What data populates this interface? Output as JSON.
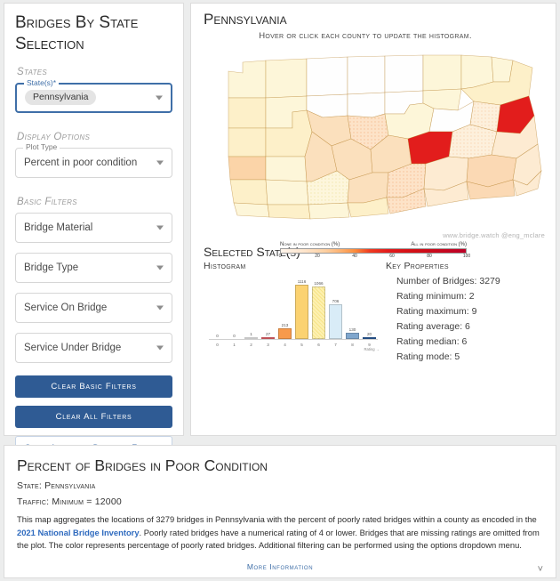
{
  "sidebar": {
    "title": "Bridges By State Selection",
    "groups": [
      {
        "label": "States",
        "fields": [
          {
            "legend": "State(s)*",
            "value": "Pennsylvania",
            "type": "chip",
            "icon": "chevron-down-icon"
          }
        ]
      },
      {
        "label": "Display Options",
        "fields": [
          {
            "legend": "Plot Type",
            "value": "Percent in poor condition",
            "type": "text",
            "icon": "chevron-down-icon"
          }
        ]
      },
      {
        "label": "Basic Filters",
        "fields": [
          {
            "legend": "",
            "value": "Bridge Material",
            "type": "text",
            "icon": "chevron-down-icon"
          },
          {
            "legend": "",
            "value": "Bridge Type",
            "type": "text",
            "icon": "chevron-down-icon"
          },
          {
            "legend": "",
            "value": "Service On Bridge",
            "type": "text",
            "icon": "chevron-down-icon"
          },
          {
            "legend": "",
            "value": "Service Under Bridge",
            "type": "text",
            "icon": "chevron-down-icon"
          }
        ]
      }
    ],
    "buttons": {
      "clear_basic": "Clear Basic Filters",
      "clear_all": "Clear All Filters",
      "advanced": "Show Advanced Detailed Filters",
      "advanced_icon": "chevron-down-icon"
    }
  },
  "map": {
    "title": "Pennsylvania",
    "subtitle": "Hover or click each county to update the histogram.",
    "watermark": "www.bridge.watch @eng_mclare",
    "colorbar": {
      "left_label": "None in poor condition (%)",
      "right_label": "All in poor condition (%)",
      "ticks": [
        "0",
        "20",
        "40",
        "60",
        "80",
        "100"
      ],
      "tick_values": [
        0,
        20,
        40,
        60,
        80,
        100
      ],
      "low_color": "#fff5eb",
      "high_color": "#bd0026"
    }
  },
  "selected_state": {
    "title": "Selected State(s)",
    "histogram_heading": "Histogram",
    "key_properties_heading": "Key Properties",
    "key_properties": [
      "Number of Bridges: 3279",
      "Rating minimum: 2",
      "Rating maximum: 9",
      "Rating average: 6",
      "Rating median: 6",
      "Rating mode: 5"
    ]
  },
  "info": {
    "title": "Percent of Bridges in Poor Condition",
    "state_line": "State: Pennsylvania",
    "traffic_line": "Traffic: Minimum = 12000",
    "body_part1": "This map aggregates the locations of 3279 bridges in Pennsylvania with the percent of poorly rated bridges within a county as encoded in the ",
    "body_link": "2021 National Bridge Inventory",
    "body_part2": ". Poorly rated bridges have a numerical rating of 4 or lower. Bridges that are missing ratings are omitted from the plot. The color represents percentage of poorly rated bridges. Additional filtering can be performed using the options dropdown menu.",
    "more_information": "More Information",
    "more_icon": "chevron-down-icon"
  },
  "chart_data": {
    "type": "bar",
    "title": "Histogram",
    "xlabel": "Rating",
    "ylabel": "",
    "categories": [
      "0",
      "1",
      "2",
      "3",
      "4",
      "5",
      "6",
      "7",
      "8",
      "9"
    ],
    "values": [
      0,
      0,
      1,
      27,
      213,
      1116,
      1066,
      706,
      130,
      20
    ],
    "labels": [
      "0",
      "0",
      "1",
      "27",
      "213",
      "1116",
      "1066",
      "706",
      "130",
      "20"
    ],
    "colors": [
      "#f2f2f2",
      "#f2f2f2",
      "#f2f2f2",
      "#e8636b",
      "#f79a4c",
      "#fbd271",
      "#fdf0b0",
      "#d9ecf7",
      "#7fa6cd",
      "#2b5d9e"
    ],
    "ylim": [
      0,
      1200
    ],
    "grid": false,
    "legend": "none"
  },
  "theme": {
    "accent": "#2f5b94",
    "link": "#2f6bbf",
    "panel_bg": "#ffffff",
    "page_bg": "#eceded"
  }
}
